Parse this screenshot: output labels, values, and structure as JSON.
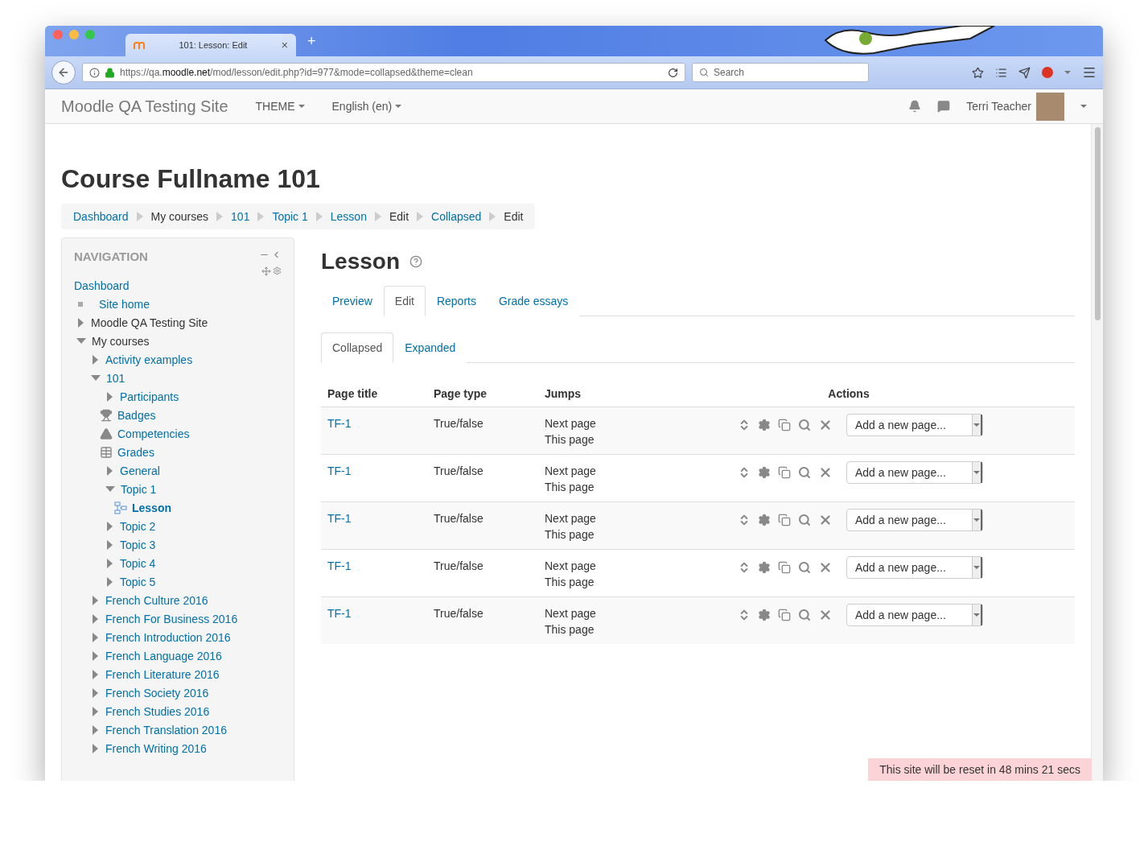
{
  "browser": {
    "tab_title": "101: Lesson: Edit",
    "tab_close": "×",
    "new_tab": "+",
    "url_prefix": "https://qa.",
    "url_domain": "moodle.net",
    "url_path": "/mod/lesson/edit.php?id=977&mode=collapsed&theme=clean",
    "search_placeholder": "Search"
  },
  "navbar": {
    "brand": "Moodle QA Testing Site",
    "menus": [
      {
        "label": "THEME"
      },
      {
        "label": "English (en)"
      }
    ],
    "user": "Terri Teacher"
  },
  "page": {
    "heading": "Course Fullname 101"
  },
  "breadcrumb": [
    {
      "label": "Dashboard",
      "link": true
    },
    {
      "label": "My courses",
      "link": false
    },
    {
      "label": "101",
      "link": true
    },
    {
      "label": "Topic 1",
      "link": true
    },
    {
      "label": "Lesson",
      "link": true
    },
    {
      "label": "Edit",
      "link": false
    },
    {
      "label": "Collapsed",
      "link": true
    },
    {
      "label": "Edit",
      "link": false
    }
  ],
  "navigation": {
    "title": "NAVIGATION",
    "items": [
      {
        "label": "Dashboard",
        "kind": "root"
      },
      {
        "label": "Site home",
        "kind": "bullet"
      },
      {
        "label": "Moodle QA Testing Site",
        "kind": "category",
        "expanded": false
      },
      {
        "label": "My courses",
        "kind": "category",
        "expanded": true,
        "children": [
          {
            "label": "Activity examples",
            "kind": "branch",
            "expanded": false
          },
          {
            "label": "101",
            "kind": "branch",
            "expanded": true,
            "children": [
              {
                "label": "Participants",
                "kind": "branch",
                "expanded": false
              },
              {
                "label": "Badges",
                "kind": "trophy"
              },
              {
                "label": "Competencies",
                "kind": "competency"
              },
              {
                "label": "Grades",
                "kind": "grades"
              },
              {
                "label": "General",
                "kind": "branch",
                "expanded": false
              },
              {
                "label": "Topic 1",
                "kind": "branch",
                "expanded": true,
                "children": [
                  {
                    "label": "Lesson",
                    "kind": "activity",
                    "current": true
                  }
                ]
              },
              {
                "label": "Topic 2",
                "kind": "branch",
                "expanded": false
              },
              {
                "label": "Topic 3",
                "kind": "branch",
                "expanded": false
              },
              {
                "label": "Topic 4",
                "kind": "branch",
                "expanded": false
              },
              {
                "label": "Topic 5",
                "kind": "branch",
                "expanded": false
              }
            ]
          },
          {
            "label": "French Culture 2016",
            "kind": "branch",
            "expanded": false
          },
          {
            "label": "French For Business 2016",
            "kind": "branch",
            "expanded": false
          },
          {
            "label": "French Introduction 2016",
            "kind": "branch",
            "expanded": false
          },
          {
            "label": "French Language 2016",
            "kind": "branch",
            "expanded": false
          },
          {
            "label": "French Literature 2016",
            "kind": "branch",
            "expanded": false
          },
          {
            "label": "French Society 2016",
            "kind": "branch",
            "expanded": false
          },
          {
            "label": "French Studies 2016",
            "kind": "branch",
            "expanded": false
          },
          {
            "label": "French Translation 2016",
            "kind": "branch",
            "expanded": false
          },
          {
            "label": "French Writing 2016",
            "kind": "branch",
            "expanded": false
          }
        ]
      }
    ]
  },
  "lesson": {
    "title": "Lesson",
    "tabs": [
      {
        "label": "Preview",
        "selected": false
      },
      {
        "label": "Edit",
        "selected": true
      },
      {
        "label": "Reports",
        "selected": false
      },
      {
        "label": "Grade essays",
        "selected": false
      }
    ],
    "subtabs": [
      {
        "label": "Collapsed",
        "selected": true
      },
      {
        "label": "Expanded",
        "selected": false
      }
    ],
    "columns": [
      "Page title",
      "Page type",
      "Jumps",
      "Actions"
    ],
    "rows": [
      {
        "title": "TF-1",
        "type": "True/false",
        "jumps": [
          "Next page",
          "This page"
        ],
        "add": "Add a new page..."
      },
      {
        "title": "TF-1",
        "type": "True/false",
        "jumps": [
          "Next page",
          "This page"
        ],
        "add": "Add a new page..."
      },
      {
        "title": "TF-1",
        "type": "True/false",
        "jumps": [
          "Next page",
          "This page"
        ],
        "add": "Add a new page..."
      },
      {
        "title": "TF-1",
        "type": "True/false",
        "jumps": [
          "Next page",
          "This page"
        ],
        "add": "Add a new page..."
      },
      {
        "title": "TF-1",
        "type": "True/false",
        "jumps": [
          "Next page",
          "This page"
        ],
        "add": "Add a new page..."
      }
    ]
  },
  "notice": "This site will be reset in 48 mins 21 secs"
}
